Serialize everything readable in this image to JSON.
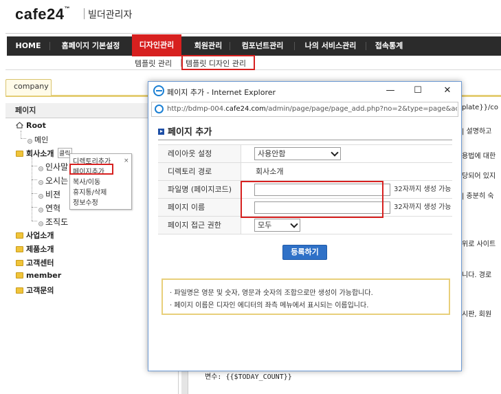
{
  "header": {
    "logo_text": "cafe24",
    "logo_tm": "™",
    "subtitle": "빌더관리자"
  },
  "nav": {
    "items": [
      {
        "label": "HOME"
      },
      {
        "label": "홈페이지 기본설정"
      },
      {
        "label": "디자인관리"
      },
      {
        "label": "회원관리"
      },
      {
        "label": "컴포넌트관리"
      },
      {
        "label": "나의 서비스관리"
      },
      {
        "label": "접속통계"
      }
    ],
    "active_color": "#d7201f"
  },
  "subnav": {
    "items": [
      {
        "label": "템플릿 관리"
      },
      {
        "label": "템플릿 디자인 관리"
      }
    ]
  },
  "tabs": {
    "company": "company"
  },
  "left_panel": {
    "title": "페이지",
    "tree": {
      "root": "Root",
      "main": "메인",
      "company": "회사소개",
      "company_sub": [
        "인사말",
        "오시는",
        "비젼",
        "연혁",
        "조직도"
      ],
      "business": "사업소개",
      "products": "제품소개",
      "support": "고객센터",
      "member": "member",
      "inquiry": "고객문의"
    },
    "context_label": "클릭",
    "context_menu": {
      "items": [
        "디렉토리추가",
        "페이지추가",
        "복사/이동",
        "휴지통/삭제",
        "정보수정"
      ],
      "close": "×"
    }
  },
  "right_bg": {
    "lines": [
      "plate}}/co",
      "| 설명하고",
      "용법에 대한",
      "당되어 있지",
      "| 충분히 숙",
      "위로 사이트",
      "니다. 경로",
      "시판, 회원"
    ],
    "bottom_var": "변수: {{$TODAY_COUNT}}"
  },
  "ie_window": {
    "title": "페이지 추가 - Internet Explorer",
    "minimize": "—",
    "maximize": "☐",
    "close": "✕",
    "url_prefix": "http://bdmp-004.",
    "url_domain": "cafe24.com",
    "url_suffix": "/admin/page/page/page_add.php?no=2&type=page&act="
  },
  "dialog": {
    "title": "페이지 추가",
    "rows": {
      "layout_label": "레이아웃 설정",
      "layout_value": "사용안함",
      "dir_label": "디렉토리 경로",
      "dir_value": "회사소개",
      "filename_label": "파일명 (페이지코드)",
      "filename_value": "",
      "filename_hint": "32자까지 생성 가능",
      "pagename_label": "페이지 이름",
      "pagename_value": "",
      "pagename_hint": "32자까지 생성 가능",
      "access_label": "페이지 접근 권한",
      "access_value": "모두"
    },
    "submit": "등록하기",
    "info": [
      "· 파일명은 영문 및 숫자, 영문과 숫자의 조합으로만 생성이 가능합니다.",
      "· 페이지 이름은 디자인 에디터의 좌측 메뉴에서 표시되는 이름입니다."
    ]
  }
}
